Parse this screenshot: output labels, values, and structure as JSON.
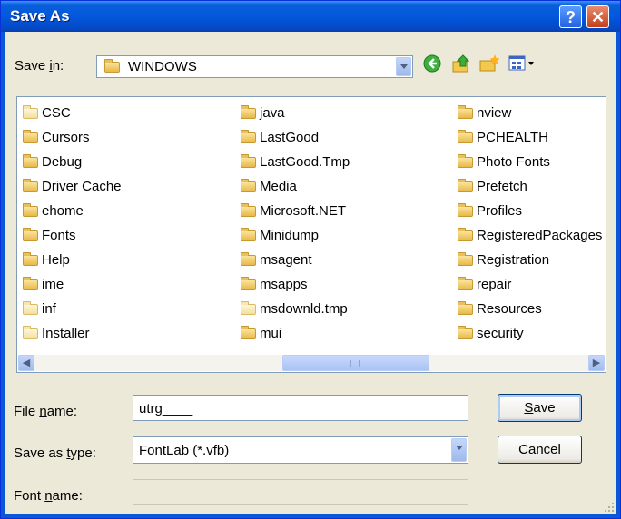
{
  "window": {
    "title": "Save As"
  },
  "titlebar": {
    "help_glyph": "?",
    "close_glyph": "✕"
  },
  "save_in": {
    "label_pre": "Save ",
    "label_ul": "i",
    "label_post": "n:",
    "value": "WINDOWS"
  },
  "toolbar": {
    "back_icon": "back-icon",
    "up_icon": "up-folder-icon",
    "new_folder_icon": "new-folder-icon",
    "views_icon": "views-menu-icon"
  },
  "files": {
    "columns": [
      [
        {
          "name": "CSC",
          "pale": true
        },
        {
          "name": "Cursors",
          "pale": false
        },
        {
          "name": "Debug",
          "pale": false
        },
        {
          "name": "Driver Cache",
          "pale": false
        },
        {
          "name": "ehome",
          "pale": false
        },
        {
          "name": "Fonts",
          "pale": false
        },
        {
          "name": "Help",
          "pale": false
        },
        {
          "name": "ime",
          "pale": false
        },
        {
          "name": "inf",
          "pale": true
        },
        {
          "name": "Installer",
          "pale": true
        }
      ],
      [
        {
          "name": "java",
          "pale": false
        },
        {
          "name": "LastGood",
          "pale": false
        },
        {
          "name": "LastGood.Tmp",
          "pale": false
        },
        {
          "name": "Media",
          "pale": false
        },
        {
          "name": "Microsoft.NET",
          "pale": false
        },
        {
          "name": "Minidump",
          "pale": false
        },
        {
          "name": "msagent",
          "pale": false
        },
        {
          "name": "msapps",
          "pale": false
        },
        {
          "name": "msdownld.tmp",
          "pale": true
        },
        {
          "name": "mui",
          "pale": false
        }
      ],
      [
        {
          "name": "nview",
          "pale": false
        },
        {
          "name": "PCHEALTH",
          "pale": false
        },
        {
          "name": "Photo Fonts",
          "pale": false
        },
        {
          "name": "Prefetch",
          "pale": false
        },
        {
          "name": "Profiles",
          "pale": false
        },
        {
          "name": "RegisteredPackages",
          "pale": false
        },
        {
          "name": "Registration",
          "pale": false
        },
        {
          "name": "repair",
          "pale": false
        },
        {
          "name": "Resources",
          "pale": false
        },
        {
          "name": "security",
          "pale": false
        }
      ]
    ]
  },
  "scrollbar": {
    "left_arrow": "◀",
    "right_arrow": "▶"
  },
  "file_name": {
    "label_pre": "File ",
    "label_ul": "n",
    "label_post": "ame:",
    "value": "utrg____"
  },
  "save_type": {
    "label_pre": "Save as ",
    "label_ul": "t",
    "label_post": "ype:",
    "value": "FontLab (*.vfb)"
  },
  "font_name": {
    "label_pre": "Font ",
    "label_ul": "n",
    "label_post": "ame:",
    "value": ""
  },
  "buttons": {
    "save_ul": "S",
    "save_rest": "ave",
    "cancel": "Cancel"
  }
}
